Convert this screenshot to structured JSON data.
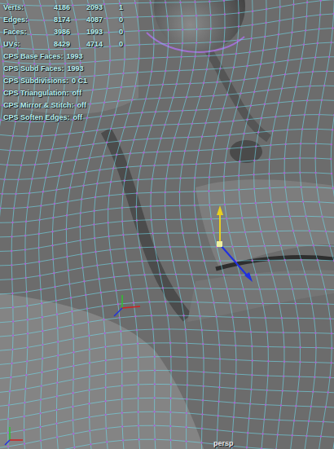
{
  "view": {
    "camera": "persp"
  },
  "hud": [
    {
      "label": "Verts:",
      "values": [
        "4186",
        "2093",
        "1"
      ]
    },
    {
      "label": "Edges:",
      "values": [
        "8174",
        "4087",
        "0"
      ]
    },
    {
      "label": "Faces:",
      "values": [
        "3986",
        "1993",
        "0"
      ]
    },
    {
      "label": "UVs:",
      "values": [
        "8429",
        "4714",
        "0"
      ]
    },
    {
      "label": "CPS Base Faces:",
      "values": [
        "1993"
      ]
    },
    {
      "label": "CPS Subd Faces:",
      "values": [
        "1993"
      ]
    },
    {
      "label": "CPS Subdivisions:",
      "values": [
        "0 C1"
      ]
    },
    {
      "label": "CPS Triangulation:",
      "values": [
        "off"
      ]
    },
    {
      "label": "CPS Mirror & Stitch:",
      "values": [
        "off"
      ]
    },
    {
      "label": "CPS Soften Edges:",
      "values": [
        "off"
      ]
    }
  ]
}
